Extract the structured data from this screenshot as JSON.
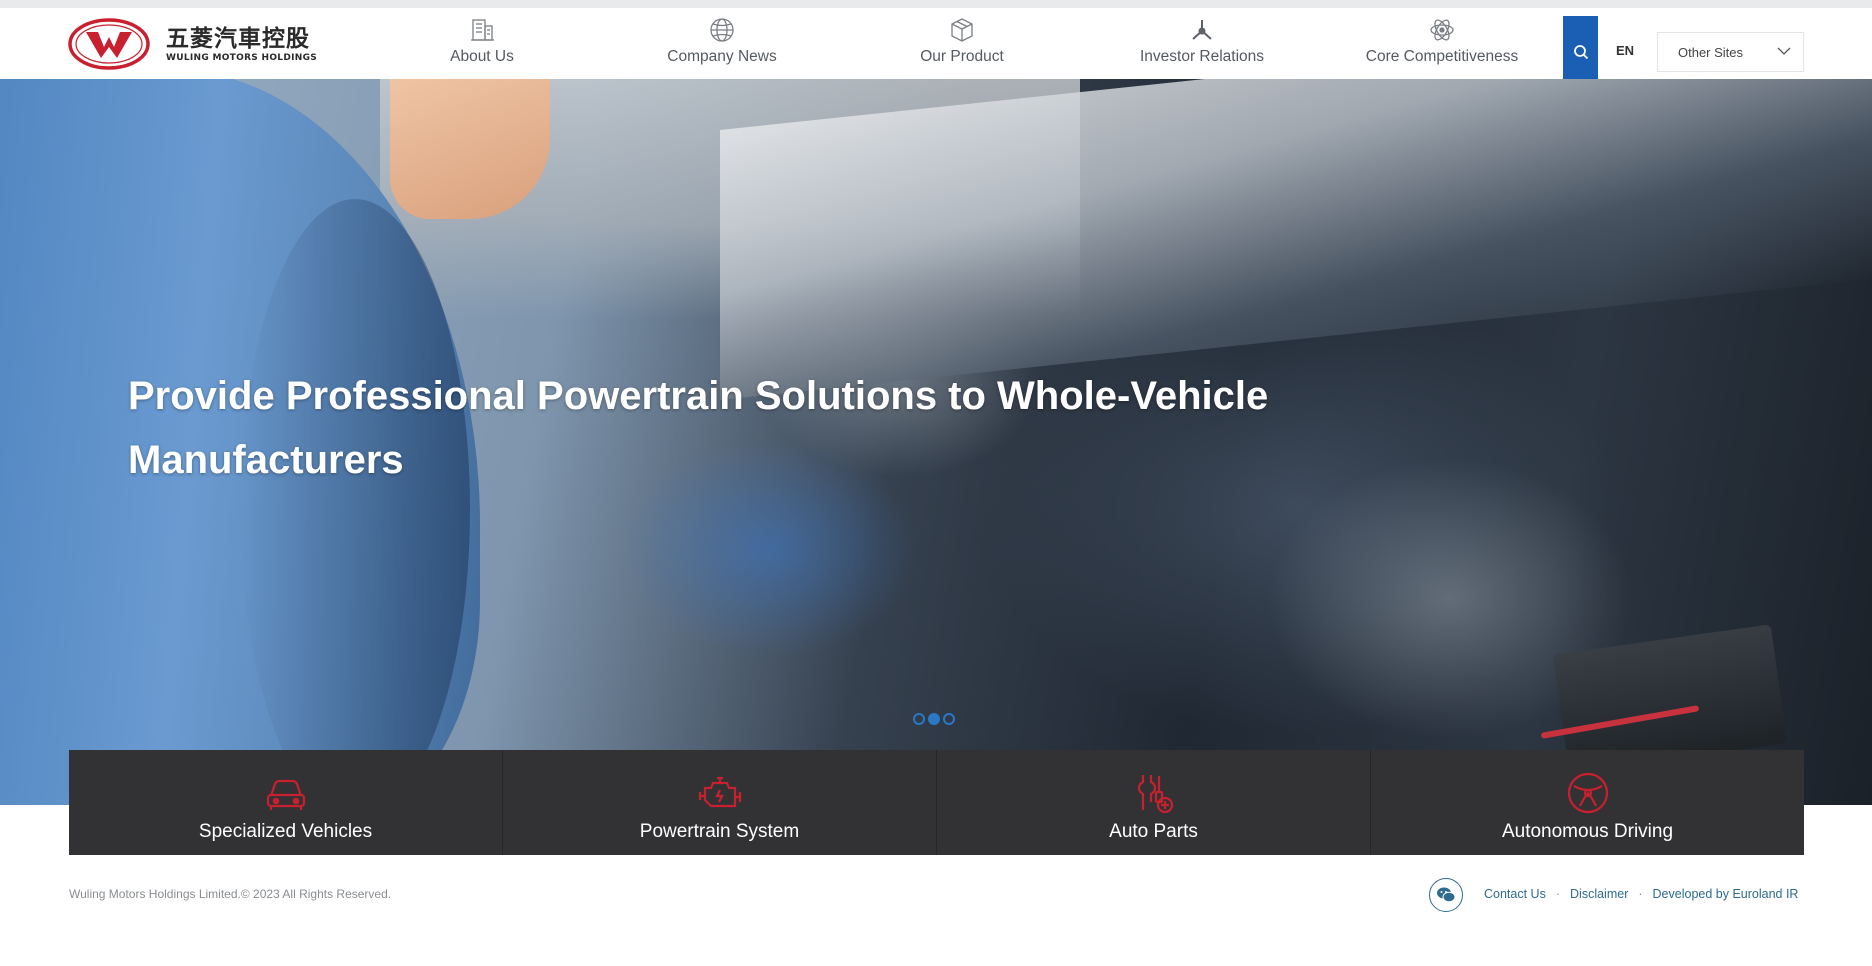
{
  "logo": {
    "cn": "五菱汽車控股",
    "en": "WULING MOTORS HOLDINGS",
    "accent": "#c8202e"
  },
  "nav": [
    {
      "label": "About Us",
      "icon": "building-icon"
    },
    {
      "label": "Company News",
      "icon": "globe-icon"
    },
    {
      "label": "Our Product",
      "icon": "box-icon"
    },
    {
      "label": "Investor Relations",
      "icon": "network-icon"
    },
    {
      "label": "Core Competitiveness",
      "icon": "atom-icon"
    }
  ],
  "header": {
    "lang": "EN",
    "other_sites": "Other Sites",
    "search_color": "#1a5fb4"
  },
  "hero": {
    "title": "Provide Professional Powertrain Solutions to Whole-Vehicle Manufacturers",
    "slides": 3,
    "active_slide": 2
  },
  "categories": [
    {
      "label": "Specialized Vehicles",
      "icon": "car-icon"
    },
    {
      "label": "Powertrain System",
      "icon": "engine-icon"
    },
    {
      "label": "Auto Parts",
      "icon": "tools-icon"
    },
    {
      "label": "Autonomous Driving",
      "icon": "steering-icon"
    }
  ],
  "footer": {
    "copyright": "Wuling Motors Holdings Limited.© 2023 All Rights Reserved.",
    "contact": "Contact Us",
    "disclaimer": "Disclaimer",
    "developer": "Developed by Euroland IR",
    "sep": "·"
  }
}
